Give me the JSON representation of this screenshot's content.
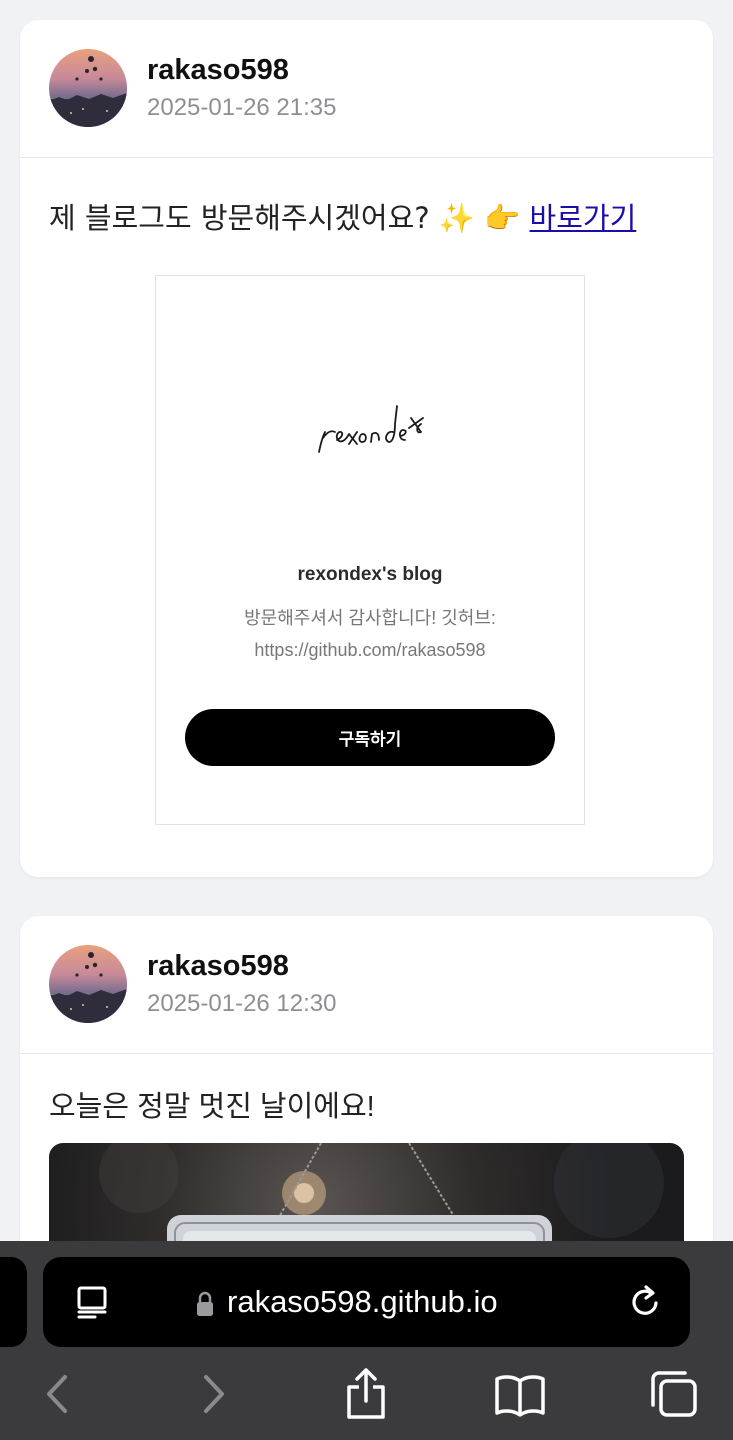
{
  "posts": [
    {
      "username": "rakaso598",
      "timestamp": "2025-01-26 21:35",
      "text": "제 블로그도 방문해주시겠어요? ✨ 👉 ",
      "link_label": "바로가기",
      "embed": {
        "title": "rexondex's blog",
        "description_line1": "방문해주셔서 감사합니다! 깃허브:",
        "description_line2": "https://github.com/rakaso598",
        "button_label": "구독하기"
      }
    },
    {
      "username": "rakaso598",
      "timestamp": "2025-01-26 12:30",
      "text": "오늘은 정말 멋진 날이에요!"
    }
  ],
  "browser": {
    "url": "rakaso598.github.io",
    "icons": [
      "reader-icon",
      "lock-icon",
      "reload-icon",
      "back-icon",
      "forward-icon",
      "share-icon",
      "bookmarks-icon",
      "tabs-icon"
    ]
  },
  "colors": {
    "link": "#1a0dab",
    "button_bg": "#000000",
    "page_bg": "#f1f2f5",
    "toolbar_bg": "#3b3b3d"
  }
}
